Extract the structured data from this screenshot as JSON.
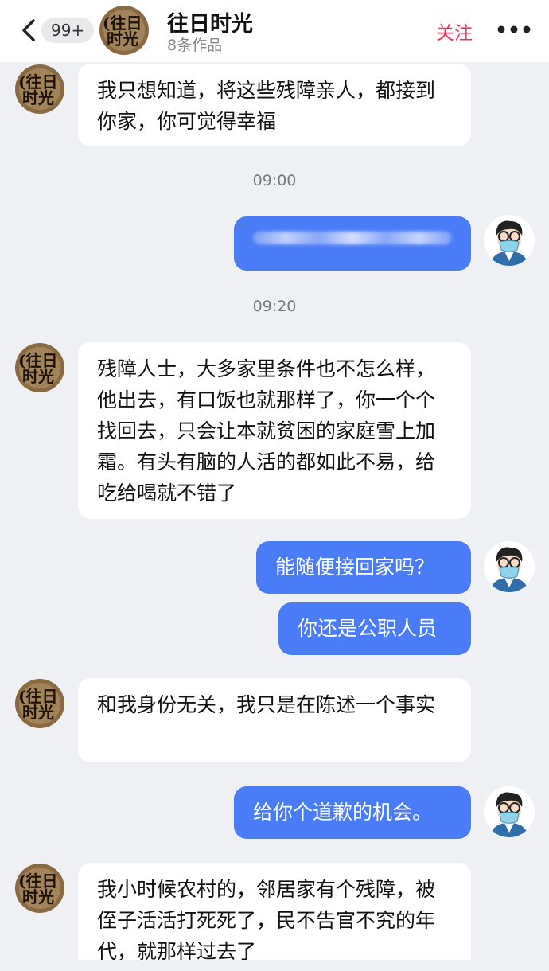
{
  "header": {
    "back_icon": "chevron-left-icon",
    "unread_badge": "99+",
    "title": "往日时光",
    "subtitle": "8条作品",
    "follow_label": "关注",
    "more_icon": "more-dots-icon"
  },
  "messages": [
    {
      "side": "left",
      "text": "我只想知道，将这些残障亲人，都接到你家，你可觉得幸福"
    },
    {
      "side": "right",
      "text": "",
      "blurred": true
    },
    {
      "side": "left",
      "text": "残障人士，大多家里条件也不怎么样，他出去，有口饭也就那样了，你一个个找回去，只会让本就贫困的家庭雪上加霜。有头有脑的人活的都如此不易，给吃给喝就不错了"
    },
    {
      "side": "right",
      "text": "能随便接回家吗？"
    },
    {
      "side": "right",
      "text": "你还是公职人员"
    },
    {
      "side": "left",
      "text": "和我身份无关，我只是在陈述一个事实"
    },
    {
      "side": "right",
      "text": "给你个道歉的机会。"
    },
    {
      "side": "left",
      "text": "我小时候农村的，邻居家有个残障，被侄子活活打死死了，民不告官不究的年代，就那样过去了"
    }
  ],
  "timestamps": [
    "09:00",
    "09:20"
  ],
  "colors": {
    "accent_blue": "#4a7cf7",
    "follow_red": "#f2345c",
    "chat_background": "#eef0f3"
  }
}
